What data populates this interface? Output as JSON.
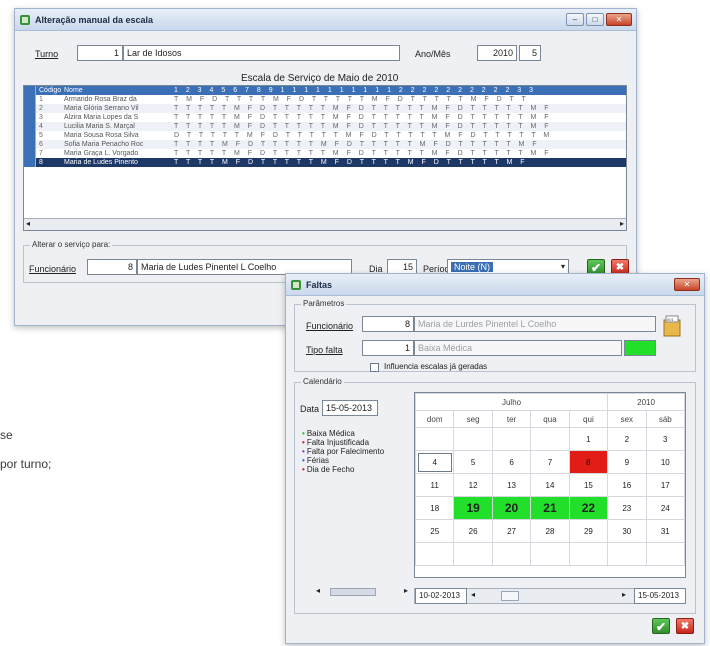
{
  "background": {
    "text1": "se",
    "text2": "por turno;"
  },
  "escala": {
    "title": "Alteração manual da escala",
    "turno_label": "Turno",
    "turno_code": "1",
    "turno_name": "Lar de Idosos",
    "anomes_label": "Ano/Mês",
    "ano": "2010",
    "mes": "5",
    "schedule_title": "Escala de Serviço de Maio de 2010",
    "grid_header": {
      "code": "Código",
      "name": "Nome",
      "days": "1 2 3 4 5 6 7 8 9 1 1 1 1 1 1 1 1 1 1 2 2 2 2 2 2 2 2 2 2 3 3"
    },
    "rows": [
      {
        "code": "1",
        "name": "Armando Rosa Braz da",
        "days": "T M F D T T T T M F D T T T T T M F D T T T T T M F D T T"
      },
      {
        "code": "2",
        "name": "Maria Glória Serrano Vil",
        "days": "T T T T T M F D T T T T T M F D T T T T T M F D T T T T T M F"
      },
      {
        "code": "3",
        "name": "Alzira Maria Lopes da S",
        "days": "T T T T T M F D T T T T T M F D T T T T T M F D T T T T T M F"
      },
      {
        "code": "4",
        "name": "Lucilia Maria S. Marçal",
        "days": "T T T T T M F D T T T T T M F D T T T T T M F D T T T T T M F"
      },
      {
        "code": "5",
        "name": "Maria Sousa Rosa Silva",
        "days": "D T T T T T M F D T T T T T M F D T T T T T M F D T T T T T M"
      },
      {
        "code": "6",
        "name": "Sofia Maria Penacho Roc",
        "days": "T T T T M F D T T T T T M F D T T T T T M F D T T T T T M F"
      },
      {
        "code": "7",
        "name": "Maria Graça L. Vorgado",
        "days": "T T T T T M F D T T T T T M F D T T T T T M F D T T T T T M F"
      },
      {
        "code": "8",
        "name": "Maria de Ludes Pinento",
        "days": "T T T T M F D T T T T T M F D T T T T M F D T T T T T M F"
      }
    ],
    "alterar_label": "Alterar o serviço para:",
    "funcionario_label": "Funcionário",
    "funcionario_code": "8",
    "funcionario_name": "Maria de Ludes Pinentel L Coelho",
    "dia_label": "Dia",
    "dia_value": "15",
    "periodo_label": "Período",
    "periodo_value": "Noite (N)"
  },
  "faltas": {
    "title": "Faltas",
    "parametros_label": "Parâmetros",
    "funcionario_label": "Funcionário",
    "funcionario_code": "8",
    "funcionario_name": "Maria de Lurdes Pinentel L Coelho",
    "tipo_label": "Tipo falta",
    "tipo_code": "1",
    "tipo_name": "Baixa Médica",
    "tipo_color": "#22e02a",
    "influencia_label": "Influencia escalas já geradas",
    "calendario_label": "Calendário",
    "data_label": "Data",
    "data_value": "15-05-2013",
    "legend": [
      {
        "label": "Baixa Médica",
        "color": "#22c72a"
      },
      {
        "label": "Falta Injustificada",
        "color": "#d0202a"
      },
      {
        "label": "Falta por Falecimento",
        "color": "#9b2fd1"
      },
      {
        "label": "Férias",
        "color": "#2a6fd0"
      },
      {
        "label": "Dia de Fecho",
        "color": "#d0202a"
      }
    ],
    "month": "Julho",
    "year": "2010",
    "weekdays": [
      "dom",
      "seg",
      "ter",
      "qua",
      "qui",
      "sex",
      "sáb"
    ],
    "weeks": [
      [
        "",
        "",
        "",
        "",
        "1",
        "2",
        "3"
      ],
      [
        "4",
        "5",
        "6",
        "7",
        "8",
        "9",
        "10"
      ],
      [
        "11",
        "12",
        "13",
        "14",
        "15",
        "16",
        "17"
      ],
      [
        "18",
        "19",
        "20",
        "21",
        "22",
        "23",
        "24"
      ],
      [
        "25",
        "26",
        "27",
        "28",
        "29",
        "30",
        "31"
      ],
      [
        "",
        "",
        "",
        "",
        "",
        "",
        ""
      ]
    ],
    "range_start": "10-02-2013",
    "range_end": "15-05-2013"
  }
}
